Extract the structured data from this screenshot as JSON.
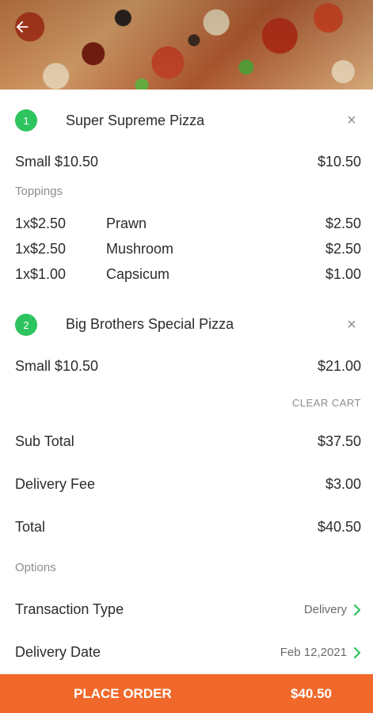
{
  "header": {
    "back_icon": "arrow-left-icon"
  },
  "items": [
    {
      "number": "1",
      "title": "Super Supreme Pizza",
      "size_label": "Small $10.50",
      "size_price": "$10.50",
      "toppings_label": "Toppings",
      "toppings": [
        {
          "qty": "1x$2.50",
          "name": "Prawn",
          "price": "$2.50"
        },
        {
          "qty": "1x$2.50",
          "name": "Mushroom",
          "price": "$2.50"
        },
        {
          "qty": "1x$1.00",
          "name": "Capsicum",
          "price": "$1.00"
        }
      ]
    },
    {
      "number": "2",
      "title": "Big Brothers Special Pizza",
      "size_label": "Small $10.50",
      "size_price": "$21.00"
    }
  ],
  "close_glyph": "×",
  "clear_cart": "CLEAR CART",
  "summary": {
    "subtotal_label": "Sub Total",
    "subtotal_value": "$37.50",
    "delivery_fee_label": "Delivery Fee",
    "delivery_fee_value": "$3.00",
    "total_label": "Total",
    "total_value": "$40.50"
  },
  "options": {
    "heading": "Options",
    "transaction_type_label": "Transaction Type",
    "transaction_type_value": "Delivery",
    "delivery_date_label": "Delivery Date",
    "delivery_date_value": "Feb 12,2021"
  },
  "footer": {
    "place_order_label": "PLACE ORDER",
    "place_order_amount": "$40.50"
  },
  "colors": {
    "accent": "#f0692a",
    "badge": "#2dc45f",
    "chevron": "#2dc45f"
  }
}
